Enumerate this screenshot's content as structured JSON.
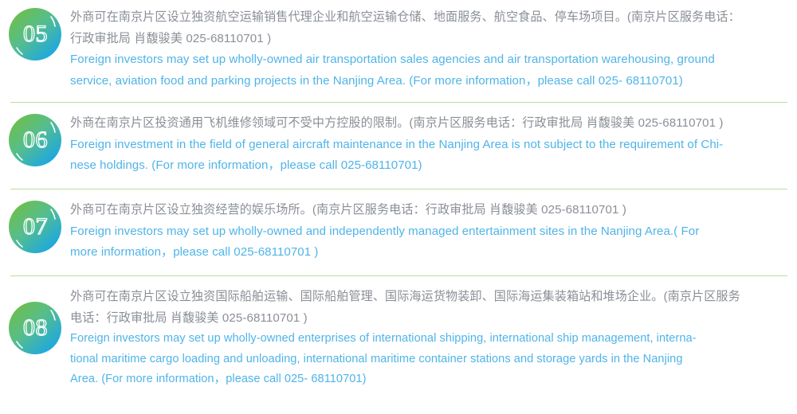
{
  "page": {
    "accent_blue": "#4fb4e8",
    "accent_green": "#7cc24f",
    "divider_color": "#b7dea0",
    "chinese_text_color": "#8a8f96"
  },
  "items": [
    {
      "number": "05",
      "zh_lines": [
        "外商可在南京片区设立独资航空运输销售代理企业和航空运输仓储、地面服务、航空食品、停车场项目。(南京片区服务电话：",
        "行政审批局 肖馥骏美 025-68110701 )"
      ],
      "en_lines": [
        "Foreign investors may set up wholly-owned air transportation sales agencies and air transportation warehousing, ground",
        "service, aviation food and parking projects in the Nanjing Area. (For more information，please call 025- 68110701)"
      ]
    },
    {
      "number": "06",
      "zh_lines": [
        "外商在南京片区投资通用飞机维修领域可不受中方控股的限制。(南京片区服务电话：行政审批局 肖馥骏美 025-68110701 )"
      ],
      "en_lines": [
        "Foreign investment in the field of general aircraft maintenance in the Nanjing Area is not subject to the requirement of Chi-",
        "nese holdings. (For more information，please call 025-68110701)"
      ]
    },
    {
      "number": "07",
      "zh_lines": [
        "外商可在南京片区设立独资经营的娱乐场所。(南京片区服务电话：行政审批局 肖馥骏美 025-68110701 )"
      ],
      "en_lines": [
        "Foreign investors may set up wholly-owned and independently managed entertainment sites in the Nanjing Area.( For",
        "more information，please call 025-68110701 )"
      ]
    },
    {
      "number": "08",
      "zh_lines": [
        "外商可在南京片区设立独资国际船舶运输、国际船舶管理、国际海运货物装卸、国际海运集装箱站和堆场企业。(南京片区服务",
        "电话：行政审批局 肖馥骏美 025-68110701 )"
      ],
      "en_lines": [
        "Foreign investors may set up wholly-owned enterprises of international shipping, international ship management, interna-",
        "tional maritime cargo loading and unloading, international maritime container stations and storage yards in the Nanjing",
        "Area. (For more information，please call  025- 68110701)"
      ]
    }
  ]
}
